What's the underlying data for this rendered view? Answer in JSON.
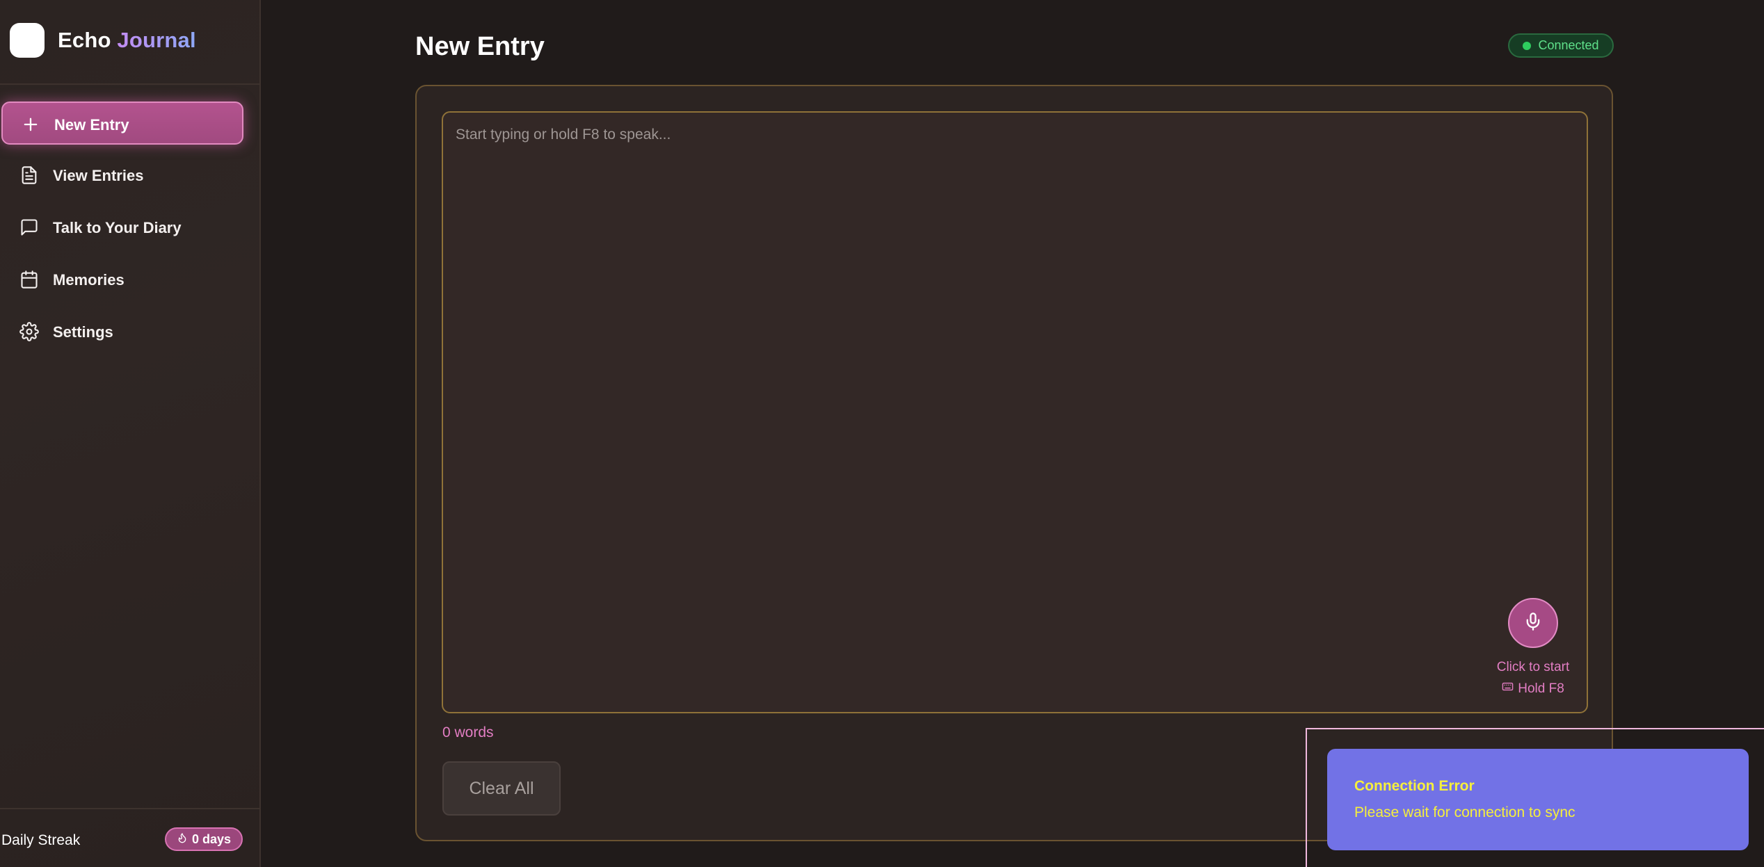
{
  "brand": {
    "name_part1": "Echo",
    "name_part2": "Journal"
  },
  "sidebar": {
    "items": [
      {
        "label": "New Entry",
        "icon": "plus-icon",
        "active": true
      },
      {
        "label": "View Entries",
        "icon": "document-icon",
        "active": false
      },
      {
        "label": "Talk to Your Diary",
        "icon": "chat-bubble-icon",
        "active": false
      },
      {
        "label": "Memories",
        "icon": "calendar-icon",
        "active": false
      },
      {
        "label": "Settings",
        "icon": "gear-icon",
        "active": false
      }
    ],
    "streak": {
      "label": "Daily Streak",
      "value": "0 days",
      "icon": "flame-icon"
    }
  },
  "header": {
    "title": "New Entry",
    "status": "Connected",
    "status_color": "#2ecc5e"
  },
  "editor": {
    "placeholder": "Start typing or hold F8 to speak...",
    "value": "",
    "mic_hint": "Click to start",
    "mic_shortcut": "Hold F8",
    "word_count": "0 words"
  },
  "actions": {
    "clear_label": "Clear All"
  },
  "toast": {
    "title": "Connection Error",
    "message": "Please wait for connection to sync"
  },
  "colors": {
    "accent": "#a64a85",
    "accent_text": "#e37ec4",
    "toast_bg": "#7272e6",
    "toast_text": "#f6ef3c"
  }
}
